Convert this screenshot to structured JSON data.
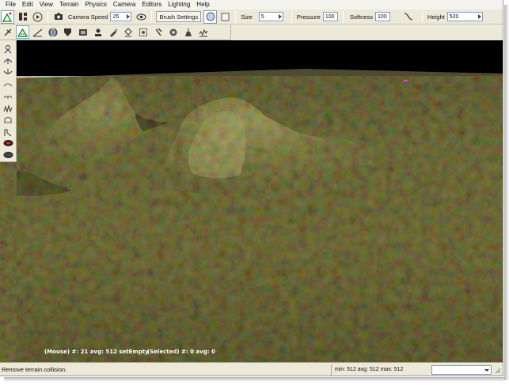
{
  "menu": [
    "File",
    "Edit",
    "View",
    "Terrain",
    "Physics",
    "Camera",
    "Editors",
    "Lighting",
    "Help"
  ],
  "toolbar": {
    "camera_speed_label": "Camera Speed",
    "camera_speed_value": "25",
    "brush_settings_label": "Brush Settings",
    "size_label": "Size",
    "size_value": "5",
    "pressure_label": "Pressure",
    "pressure_value": "100",
    "softness_label": "Softness",
    "softness_value": "100",
    "height_label": "Height",
    "height_value": "520"
  },
  "viewport": {
    "mouse_info": "(Mouse) #: 21  avg: 512 setEmpty",
    "selected_info": "(Selected) #: 0  avg: 0"
  },
  "status": {
    "message": "Remove terrain collision.",
    "stats": "min: 512  avg: 512  max: 512",
    "combo_value": ""
  },
  "icons": {
    "toolbar1": [
      "terrain-editor-icon",
      "split-view-icon",
      "play-icon",
      "camera-icon",
      "eye-icon",
      "circle-brush-icon",
      "square-brush-icon",
      "softness-curve-icon"
    ],
    "toolbar2": [
      "terrain-mode-icon",
      "elevation-icon",
      "globe-icon",
      "shield-icon",
      "film-icon",
      "stamp-icon",
      "paint-icon",
      "bucket-icon",
      "select-icon",
      "move-icon",
      "smooth-icon",
      "flatten-icon",
      "noise-icon"
    ],
    "left_tools": [
      "raise-icon",
      "lower-icon",
      "set-height-icon",
      "smooth-icon",
      "adjust-icon",
      "peaks-icon",
      "scale-icon",
      "clear-icon",
      "erase-icon",
      "oval-brush-icon"
    ]
  },
  "colors": {
    "sky": "#000000",
    "terrain_base": "#5a5832",
    "accent": "#e040d0"
  }
}
